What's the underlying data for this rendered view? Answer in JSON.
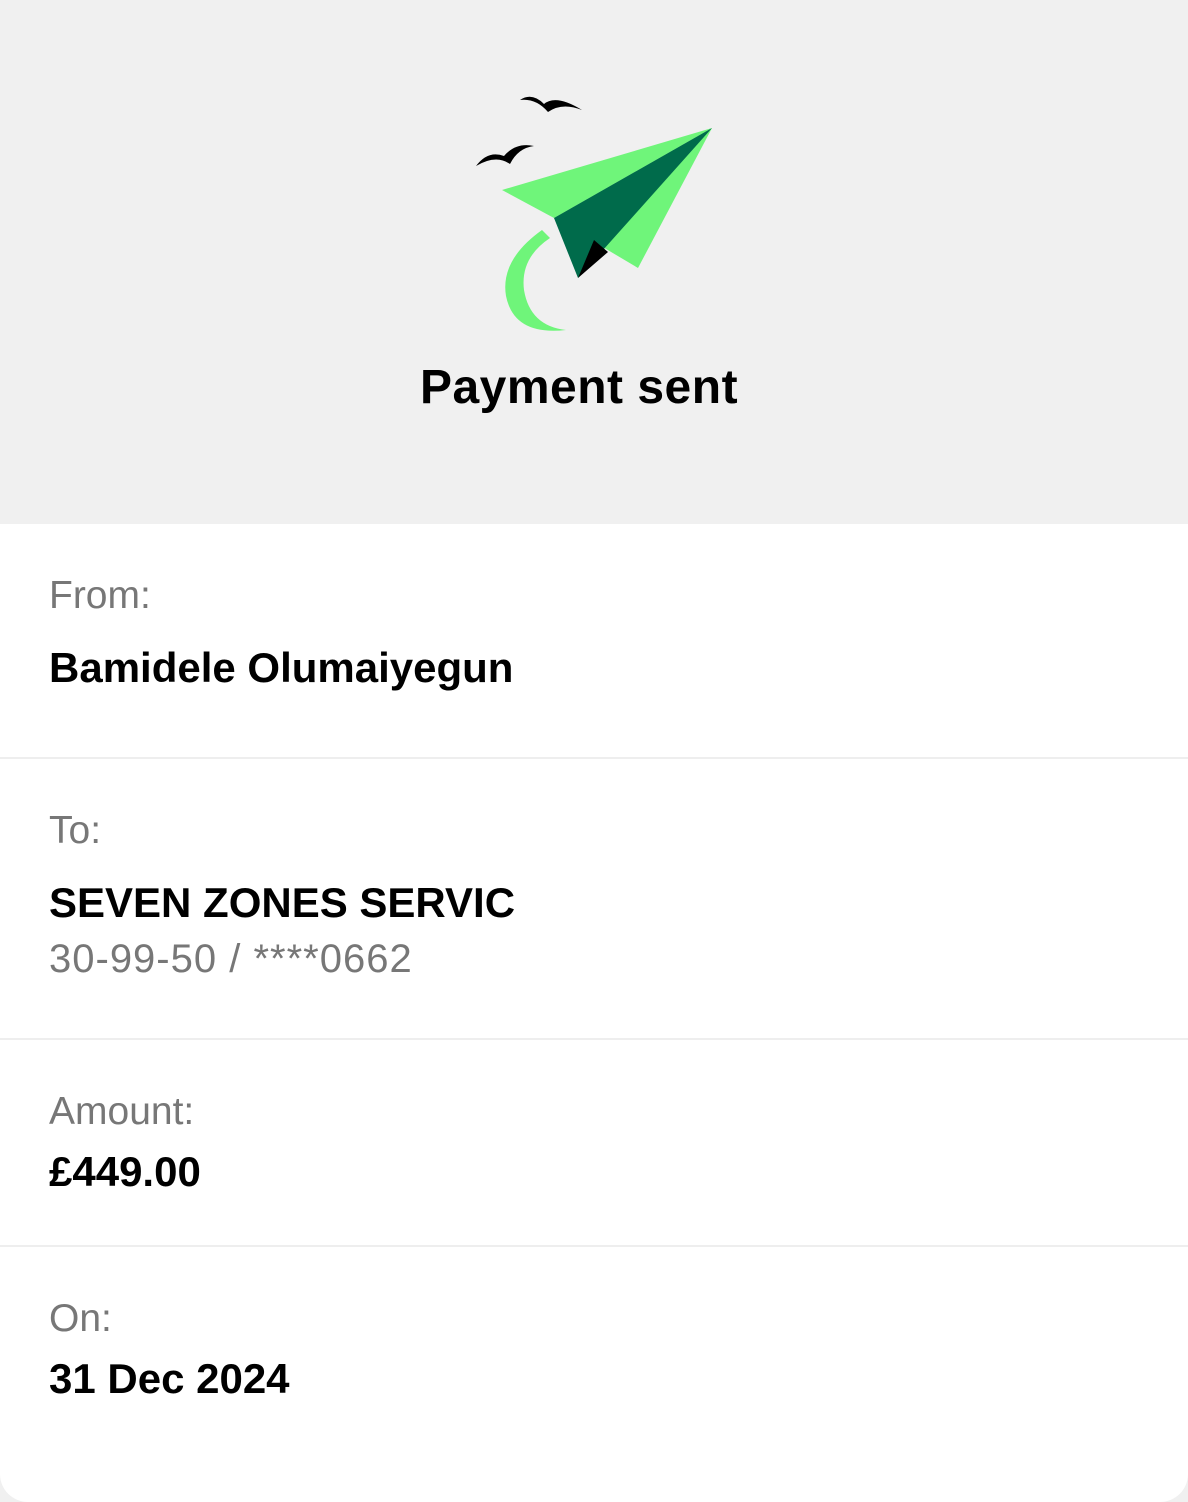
{
  "header": {
    "illustration_icon": "paper-plane-icon",
    "title": "Payment sent",
    "colors": {
      "plane_light": "#6ff57a",
      "plane_dark": "#006b4b",
      "birds": "#000000"
    }
  },
  "details": {
    "from": {
      "label": "From:",
      "value": "Bamidele Olumaiyegun"
    },
    "to": {
      "label": "To:",
      "value": "SEVEN ZONES SERVIC",
      "account": "30-99-50 / ****0662"
    },
    "amount": {
      "label": "Amount:",
      "value": "£449.00"
    },
    "on": {
      "label": "On:",
      "value": "31 Dec 2024"
    }
  }
}
